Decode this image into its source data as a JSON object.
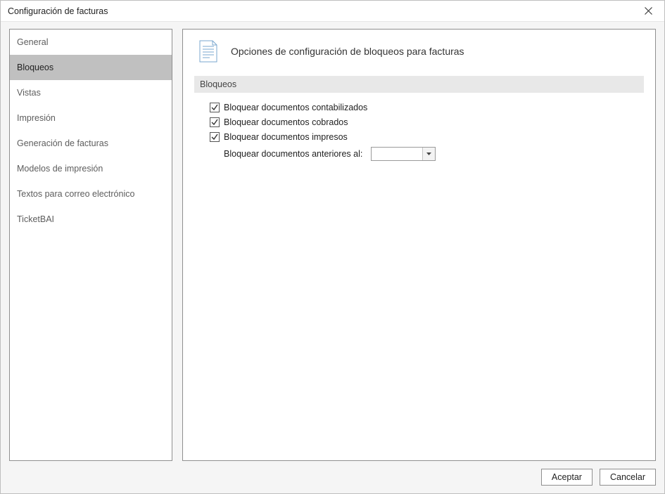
{
  "window": {
    "title": "Configuración de facturas"
  },
  "sidebar": {
    "items": [
      {
        "label": "General",
        "selected": false
      },
      {
        "label": "Bloqueos",
        "selected": true
      },
      {
        "label": "Vistas",
        "selected": false
      },
      {
        "label": "Impresión",
        "selected": false
      },
      {
        "label": "Generación de facturas",
        "selected": false
      },
      {
        "label": "Modelos de impresión",
        "selected": false
      },
      {
        "label": "Textos para correo electrónico",
        "selected": false
      },
      {
        "label": "TicketBAI",
        "selected": false
      }
    ]
  },
  "main": {
    "title": "Opciones de configuración de bloqueos para facturas",
    "section_header": "Bloqueos",
    "checkboxes": [
      {
        "label": "Bloquear documentos contabilizados",
        "checked": true
      },
      {
        "label": "Bloquear documentos cobrados",
        "checked": true
      },
      {
        "label": "Bloquear documentos impresos",
        "checked": true
      }
    ],
    "date_row": {
      "label": "Bloquear documentos anteriores al:",
      "value": ""
    }
  },
  "footer": {
    "accept_label": "Aceptar",
    "cancel_label": "Cancelar"
  }
}
